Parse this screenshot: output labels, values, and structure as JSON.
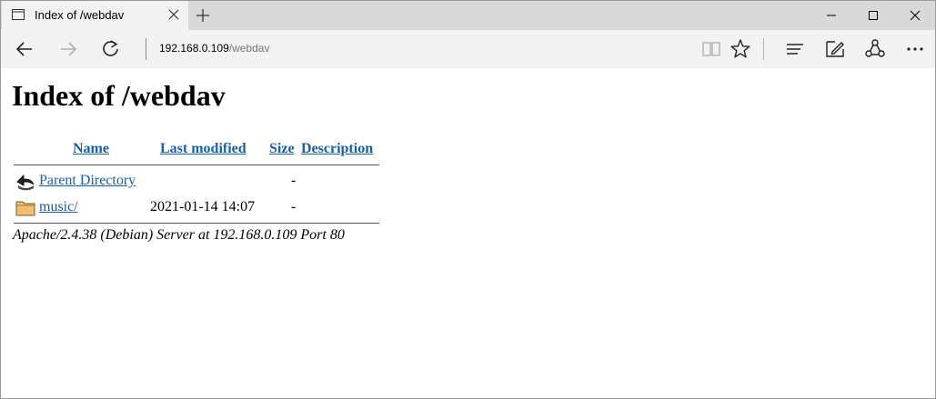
{
  "browser": {
    "tab": {
      "title": "Index of /webdav"
    },
    "address": {
      "host": "192.168.0.109",
      "path": "/webdav"
    }
  },
  "page": {
    "heading": "Index of /webdav",
    "columns": {
      "name": "Name",
      "last_modified": "Last modified",
      "size": "Size",
      "description": "Description"
    },
    "rows": [
      {
        "icon": "back-arrow-icon",
        "name": "Parent Directory",
        "last_modified": "",
        "size": "-",
        "description": ""
      },
      {
        "icon": "folder-icon",
        "name": "music/",
        "last_modified": "2021-01-14 14:07",
        "size": "-",
        "description": ""
      }
    ],
    "footer": "Apache/2.4.38 (Debian) Server at 192.168.0.109 Port 80"
  },
  "colors": {
    "link": "#1a5ea8",
    "titlebar": "#d9d9d9",
    "toolbar": "#f2f2f2"
  }
}
